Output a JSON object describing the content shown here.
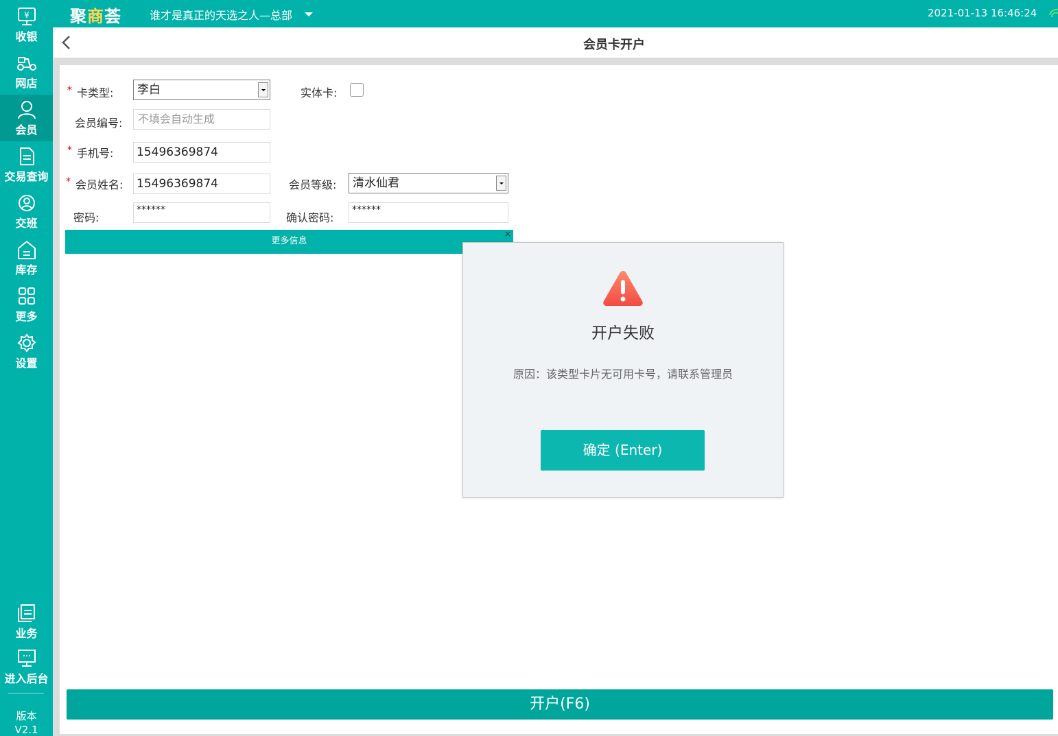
{
  "app": {
    "logo_part1": "聚",
    "logo_accent": "商",
    "logo_part2": "荟",
    "store_name": "谁才是真正的天选之人—总部",
    "datetime": "2021-01-13 16:46:24"
  },
  "sidebar": {
    "items": [
      {
        "label": "收银",
        "icon": "cashier-icon"
      },
      {
        "label": "网店",
        "icon": "scooter-icon"
      },
      {
        "label": "会员",
        "icon": "user-icon"
      },
      {
        "label": "交易查询",
        "icon": "document-icon"
      },
      {
        "label": "交班",
        "icon": "shift-icon"
      },
      {
        "label": "库存",
        "icon": "warehouse-icon"
      },
      {
        "label": "更多",
        "icon": "grid-icon"
      },
      {
        "label": "设置",
        "icon": "gear-icon"
      },
      {
        "label": "业务",
        "icon": "book-icon"
      },
      {
        "label": "进入后台",
        "icon": "monitor-icon"
      }
    ],
    "version_label": "版本",
    "version_value": "V2.1"
  },
  "header": {
    "title": "会员卡开户"
  },
  "form": {
    "required_mark": "*",
    "card_type_label": "卡类型:",
    "card_type_value": "李白",
    "physical_card_label": "实体卡:",
    "member_no_label": "会员编号:",
    "member_no_placeholder": "不填会自动生成",
    "phone_label": "手机号:",
    "phone_value": "15496369874",
    "name_label": "会员姓名:",
    "name_value": "15496369874",
    "level_label": "会员等级:",
    "level_value": "清水仙君",
    "password_label": "密码:",
    "password_value": "******",
    "confirm_password_label": "确认密码:",
    "confirm_password_value": "******",
    "more_info_label": "更多信息",
    "more_info_close": "×",
    "submit_label": "开户(F6)"
  },
  "dialog": {
    "icon": "warning-icon",
    "title": "开户失败",
    "reason": "原因：该类型卡片无可用卡号，请联系管理员",
    "ok_label": "确定 (Enter)"
  },
  "colors": {
    "primary": "#00b2a9",
    "primary_dark": "#00a69c",
    "required": "#e60012",
    "warning": "#f25c4e"
  }
}
